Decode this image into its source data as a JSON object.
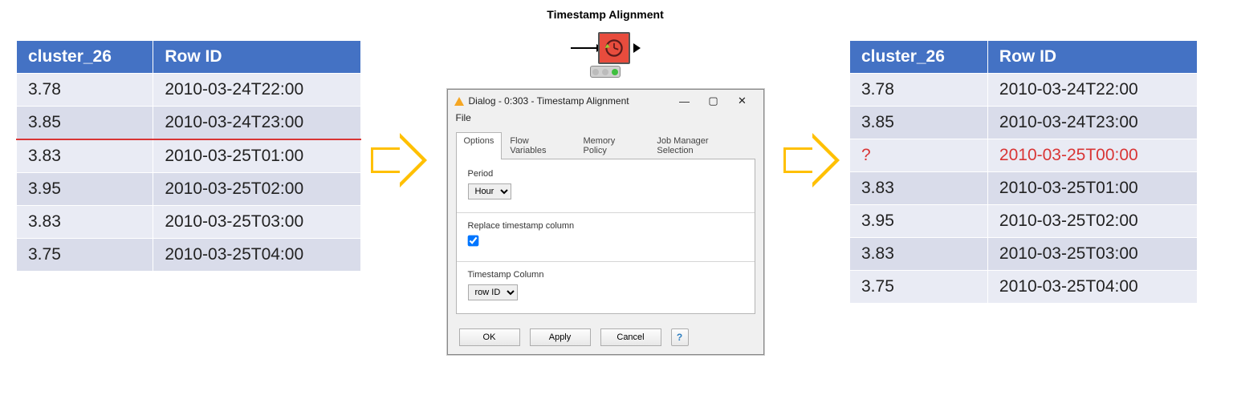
{
  "node": {
    "title": "Timestamp Alignment"
  },
  "headers": {
    "col1": "cluster_26",
    "col2": "Row ID"
  },
  "left_table": [
    {
      "v": "3.78",
      "ts": "2010-03-24T22:00",
      "gap": false
    },
    {
      "v": "3.85",
      "ts": "2010-03-24T23:00",
      "gap": false
    },
    {
      "v": "3.83",
      "ts": "2010-03-25T01:00",
      "gap": true
    },
    {
      "v": "3.95",
      "ts": "2010-03-25T02:00",
      "gap": false
    },
    {
      "v": "3.83",
      "ts": "2010-03-25T03:00",
      "gap": false
    },
    {
      "v": "3.75",
      "ts": "2010-03-25T04:00",
      "gap": false
    }
  ],
  "right_table": [
    {
      "v": "3.78",
      "ts": "2010-03-24T22:00",
      "highlight": false
    },
    {
      "v": "3.85",
      "ts": "2010-03-24T23:00",
      "highlight": false
    },
    {
      "v": "?",
      "ts": "2010-03-25T00:00",
      "highlight": true
    },
    {
      "v": "3.83",
      "ts": "2010-03-25T01:00",
      "highlight": false
    },
    {
      "v": "3.95",
      "ts": "2010-03-25T02:00",
      "highlight": false
    },
    {
      "v": "3.83",
      "ts": "2010-03-25T03:00",
      "highlight": false
    },
    {
      "v": "3.75",
      "ts": "2010-03-25T04:00",
      "highlight": false
    }
  ],
  "dialog": {
    "title": "Dialog - 0:303 - Timestamp Alignment",
    "menu": {
      "file": "File"
    },
    "tabs": {
      "options": "Options",
      "flow": "Flow Variables",
      "memory": "Memory Policy",
      "job": "Job Manager Selection"
    },
    "period_label": "Period",
    "period_value": "Hour",
    "replace_label": "Replace timestamp column",
    "replace_checked": true,
    "tscol_label": "Timestamp Column",
    "tscol_value": "row ID",
    "buttons": {
      "ok": "OK",
      "apply": "Apply",
      "cancel": "Cancel",
      "help": "?"
    }
  }
}
